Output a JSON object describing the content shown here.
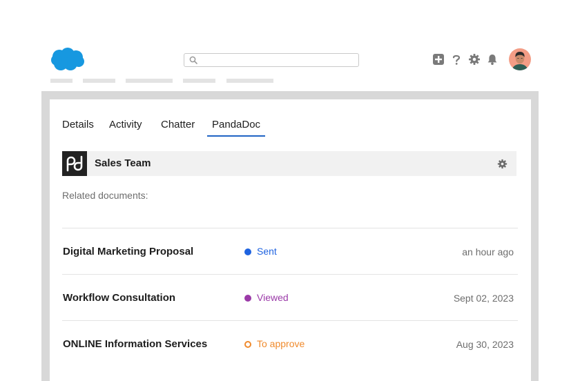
{
  "header": {
    "search": {
      "value": "",
      "placeholder": ""
    },
    "icons": [
      "salesforce-cloud-logo",
      "add-icon",
      "help-icon",
      "gear-icon",
      "bell-icon",
      "avatar"
    ]
  },
  "tabs": [
    {
      "label": "Details"
    },
    {
      "label": "Activity"
    },
    {
      "label": "Chatter"
    },
    {
      "label": "PandaDoc",
      "active": true
    }
  ],
  "card": {
    "title": "Sales Team"
  },
  "related_label": "Related documents:",
  "documents": [
    {
      "name": "Digital Marketing Proposal",
      "status": "Sent",
      "status_color": "#1f63e0",
      "date": "an hour ago"
    },
    {
      "name": "Workflow Consultation",
      "status": "Viewed",
      "status_color": "#9b3aa8",
      "date": "Sept 02, 2023"
    },
    {
      "name": "ONLINE Information Services",
      "status": "To approve",
      "status_color": "#f08a2c",
      "date": "Aug 30, 2023"
    }
  ],
  "colors": {
    "accent": "#1f63c4",
    "salesforce_blue": "#1798e0",
    "frame": "#d8d8d8"
  }
}
